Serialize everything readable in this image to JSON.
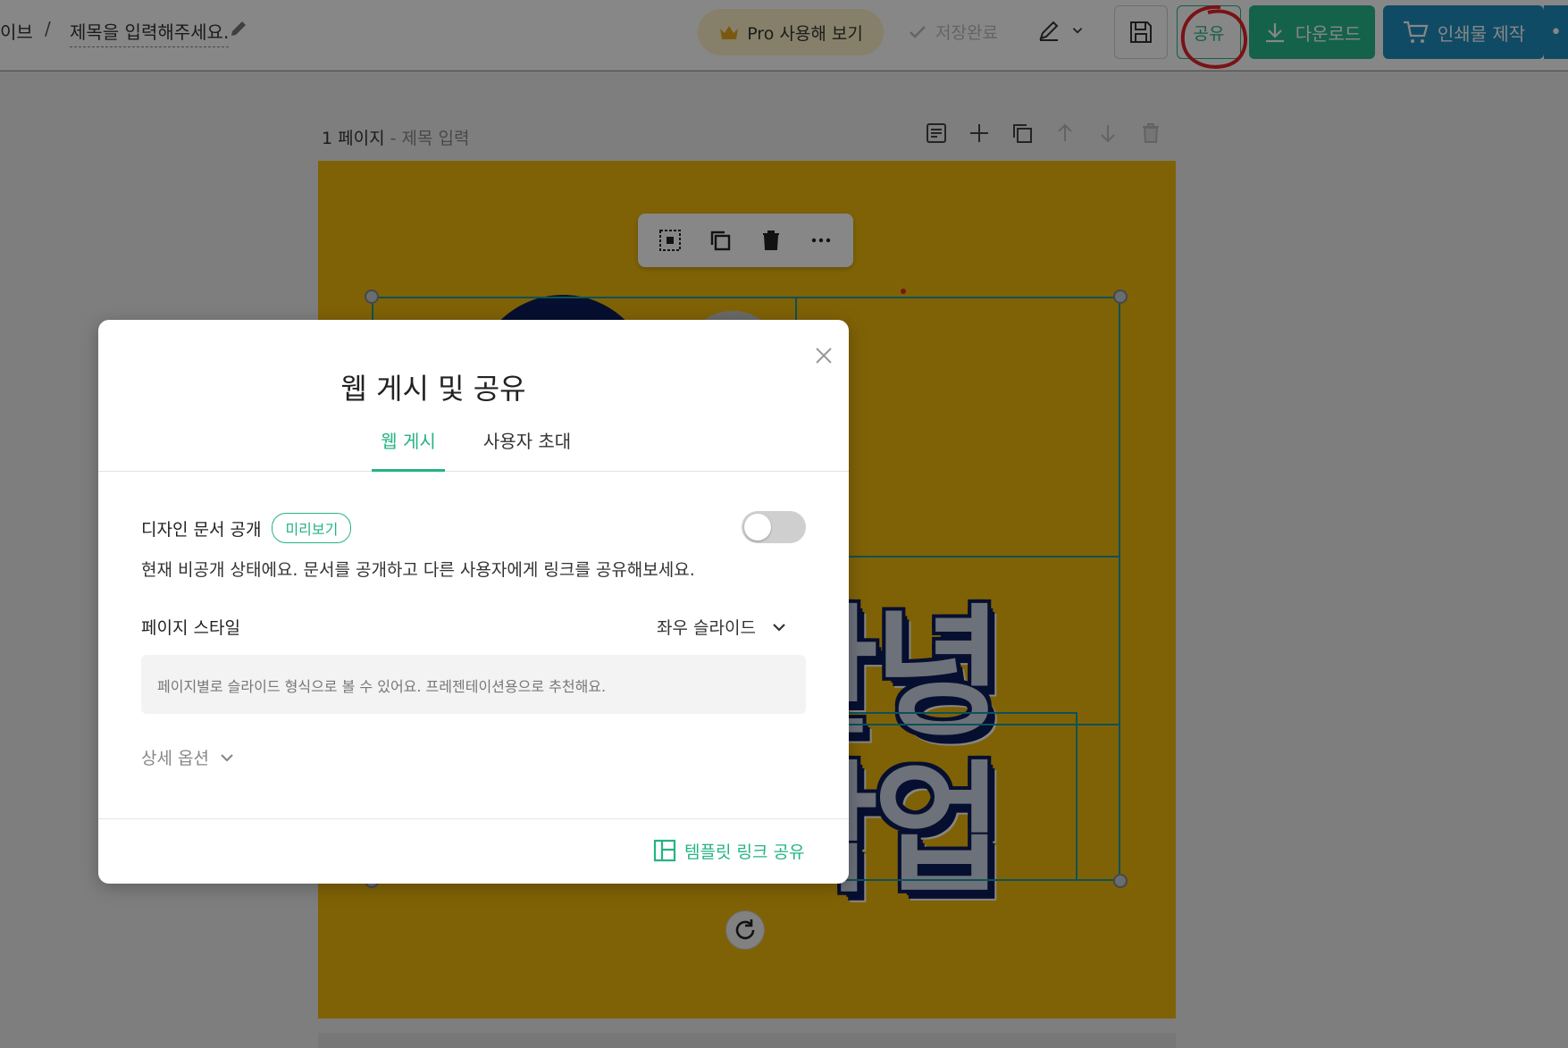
{
  "topbar": {
    "drive_crumb": "이브",
    "separator": "/",
    "doc_title": "제목을 입력해주세요.",
    "pro_button": "Pro 사용해 보기",
    "saved_status": "저장완료",
    "share_button": "공유",
    "download_button": "다운로드",
    "print_button": "인쇄물 제작",
    "more_button": "•",
    "annotation_color": "#e3242b"
  },
  "editor": {
    "page_label": "1 페이지",
    "page_sep": " - ",
    "page_title_placeholder": "제목 입력",
    "canvas_color": "#f1b90d",
    "art_text_line1": "안녕",
    "art_text_line2": "작업"
  },
  "modal": {
    "title": "웹 게시 및 공유",
    "tabs": [
      {
        "label": "웹 게시",
        "active": true
      },
      {
        "label": "사용자 초대",
        "active": false
      }
    ],
    "public_label": "디자인 문서 공개",
    "preview_badge": "미리보기",
    "public_toggle": false,
    "description": "현재 비공개 상태에요. 문서를 공개하고 다른 사용자에게 링크를 공유해보세요.",
    "page_style_label": "페이지 스타일",
    "page_style_value": "좌우 슬라이드",
    "page_style_info": "페이지별로 슬라이드 형식으로 볼 수 있어요. 프레젠테이션용으로 추천해요.",
    "detail_options": "상세 옵션",
    "template_link": "템플릿 링크 공유",
    "accent_color": "#23b482"
  }
}
